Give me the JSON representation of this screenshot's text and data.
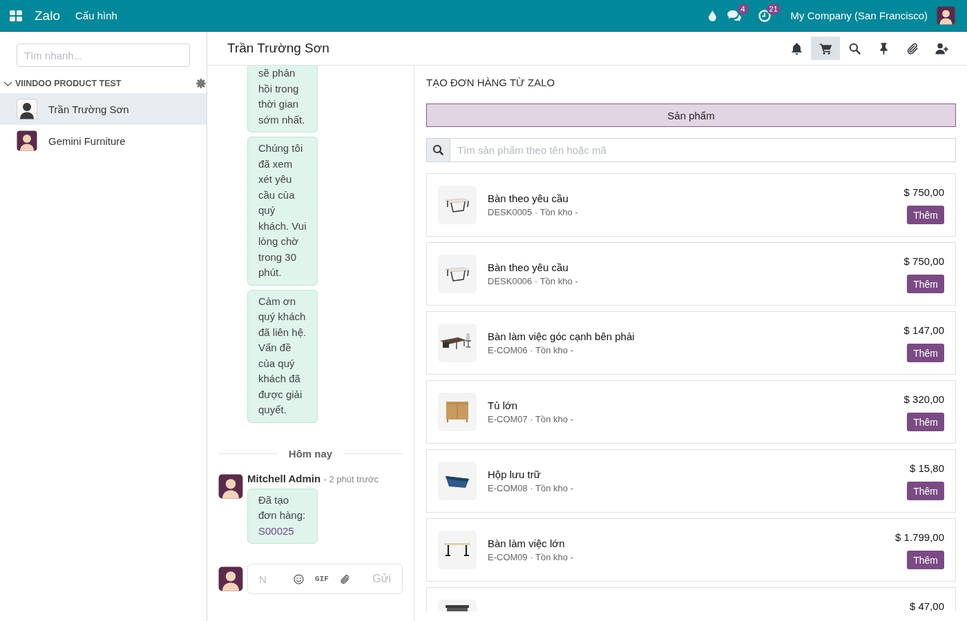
{
  "navbar": {
    "app_name": "Zalo",
    "menu": [
      "Cấu hình"
    ],
    "systray": [
      {
        "kind": "drop"
      },
      {
        "kind": "chat",
        "badge": "4"
      },
      {
        "kind": "activity",
        "badge": "21"
      }
    ],
    "company": "My Company (San Francisco)"
  },
  "sidebar": {
    "search": {
      "placeholder": "Tìm nhanh..."
    },
    "group": {
      "title": "VIINDOO PRODUCT TEST",
      "expanded": true
    },
    "contacts": [
      {
        "kind": "sketch",
        "name": "Trần Trường Sơn",
        "selected": true
      },
      {
        "kind": "cartoon",
        "name": "Gemini Furniture",
        "selected": false
      }
    ]
  },
  "thread": {
    "title": "Trần Trường Sơn",
    "toolbar": [
      {
        "kind": "bell",
        "selected": false
      },
      {
        "kind": "cart",
        "selected": true
      },
      {
        "kind": "search",
        "selected": false
      },
      {
        "kind": "pin",
        "selected": false
      },
      {
        "kind": "paperclip",
        "selected": false
      },
      {
        "kind": "add-user",
        "selected": false
      }
    ],
    "messages": [
      {
        "kind": "bubble",
        "text": "sẽ phản hồi trong thời gian sớm nhất."
      },
      {
        "kind": "bubble",
        "text": "Chúng tôi đã xem xét yêu cầu của quý khách. Vui lòng chờ trong 30 phút."
      },
      {
        "kind": "bubble",
        "text": "Cảm ơn quý khách đã liên hệ. Vấn đề của quý khách đã được giải quyết."
      },
      {
        "kind": "separator",
        "text": "Hôm nay"
      },
      {
        "kind": "post",
        "author": "Mitchell Admin",
        "time": "- 2 phút trước",
        "text": "Đã tạo đơn hàng:",
        "link": "S00025"
      }
    ],
    "composer": {
      "placeholder": "N",
      "gif": "GIF",
      "send": {
        "label": "Gửi",
        "disabled": true
      }
    }
  },
  "order_panel": {
    "title": "TẠO ĐƠN HÀNG TỪ ZALO",
    "tabs": [
      {
        "label": "Sản phẩm",
        "selected": true
      }
    ],
    "search": {
      "placeholder": "Tìm sản phẩm theo tên hoặc mã"
    },
    "products": [
      {
        "kind": "desk",
        "name": "Bàn theo yêu cầu",
        "meta": "DESK0005 · Tồn kho -",
        "price": "$ 750,00",
        "button": "Thêm"
      },
      {
        "kind": "desk",
        "name": "Bàn theo yêu cầu",
        "meta": "DESK0006 · Tồn kho -",
        "price": "$ 750,00",
        "button": "Thêm"
      },
      {
        "kind": "corner-desk",
        "name": "Bàn làm việc góc cạnh bên phải",
        "meta": "E-COM06 · Tồn kho -",
        "price": "$ 147,00",
        "button": "Thêm"
      },
      {
        "kind": "cabinet",
        "name": "Tủ lớn",
        "meta": "E-COM07 · Tồn kho -",
        "price": "$ 320,00",
        "button": "Thêm"
      },
      {
        "kind": "basket",
        "name": "Hộp lưu trữ",
        "meta": "E-COM08 · Tồn kho -",
        "price": "$ 15,80",
        "button": "Thêm"
      },
      {
        "kind": "large-desk",
        "name": "Bàn làm việc lớn",
        "meta": "E-COM09 · Tồn kho -",
        "price": "$ 1.799,00",
        "button": "Thêm"
      },
      {
        "kind": "bin",
        "price": "$ 47,00"
      }
    ]
  }
}
